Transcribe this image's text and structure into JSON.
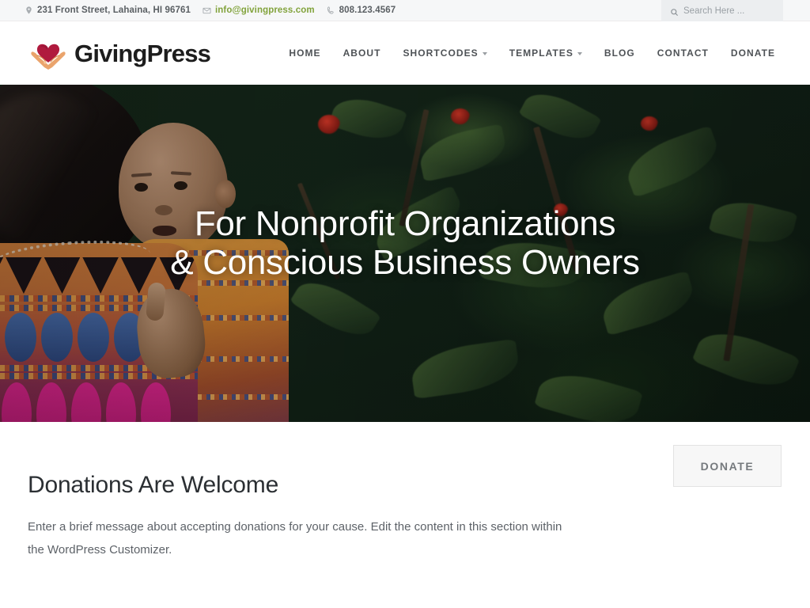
{
  "topbar": {
    "address": "231 Front Street, Lahaina, HI 96761",
    "email": "info@givingpress.com",
    "phone": "808.123.4567",
    "address_icon": "map-pin-icon",
    "email_icon": "envelope-icon",
    "phone_icon": "phone-icon",
    "search": {
      "icon": "search-icon",
      "placeholder": "Search Here ...",
      "value": ""
    },
    "colors": {
      "background": "#f6f7f8",
      "text": "#5a5f63",
      "email_link": "#82a33c",
      "search_background": "#eceef0"
    }
  },
  "header": {
    "logo_icon": "heart-in-hands-icon",
    "site_title": "GivingPress",
    "logo_colors": {
      "heart": "#b01a3e",
      "hands": "#e9a068"
    },
    "nav": [
      {
        "label": "HOME",
        "has_dropdown": false
      },
      {
        "label": "ABOUT",
        "has_dropdown": false
      },
      {
        "label": "SHORTCODES",
        "has_dropdown": true
      },
      {
        "label": "TEMPLATES",
        "has_dropdown": true
      },
      {
        "label": "BLOG",
        "has_dropdown": false
      },
      {
        "label": "CONTACT",
        "has_dropdown": false
      },
      {
        "label": "DONATE",
        "has_dropdown": false
      }
    ]
  },
  "hero": {
    "headline_line1": "For Nonprofit Organizations",
    "headline_line2": "& Conscious Business Owners",
    "image_description": "woman in colorful traditional textile carrying a baby in front of dark green foliage with red flowers",
    "text_color": "#ffffff"
  },
  "donation": {
    "title": "Donations Are Welcome",
    "body": "Enter a brief message about accepting donations for your cause. Edit the content in this section within the WordPress Customizer.",
    "button_label": "DONATE",
    "button_colors": {
      "background": "#f7f7f7",
      "border": "#e3e3e3",
      "text": "#75797d"
    }
  }
}
